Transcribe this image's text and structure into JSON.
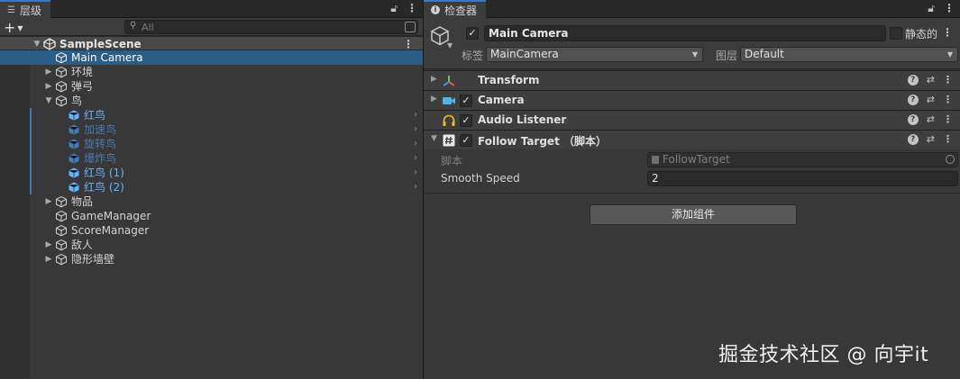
{
  "hierarchy": {
    "tab_label": "层级",
    "search_placeholder": "All",
    "scene_name": "SampleScene",
    "items": [
      {
        "label": "Main Camera",
        "state": "selected"
      },
      {
        "label": "环境",
        "state": "normal"
      },
      {
        "label": "弹弓",
        "state": "normal"
      },
      {
        "label": "鸟",
        "state": "expanded"
      },
      {
        "label": "红鸟",
        "state": "prefab"
      },
      {
        "label": "加速鸟",
        "state": "prefab-dim"
      },
      {
        "label": "旋转鸟",
        "state": "prefab-dim"
      },
      {
        "label": "爆炸鸟",
        "state": "prefab-dim"
      },
      {
        "label": "红鸟 (1)",
        "state": "prefab"
      },
      {
        "label": "红鸟 (2)",
        "state": "prefab"
      },
      {
        "label": "物品",
        "state": "normal"
      },
      {
        "label": "GameManager",
        "state": "normal"
      },
      {
        "label": "ScoreManager",
        "state": "normal"
      },
      {
        "label": "敌人",
        "state": "normal"
      },
      {
        "label": "隐形墙壁",
        "state": "normal"
      }
    ]
  },
  "inspector": {
    "tab_label": "检查器",
    "object_name": "Main Camera",
    "static_label": "静态的",
    "tag_label": "标签",
    "tag_value": "MainCamera",
    "layer_label": "图层",
    "layer_value": "Default",
    "components": [
      {
        "title": "Transform"
      },
      {
        "title": "Camera"
      },
      {
        "title": "Audio Listener"
      },
      {
        "title": "Follow Target （脚本）"
      }
    ],
    "script_label": "脚本",
    "script_value": "FollowTarget",
    "smooth_speed_label": "Smooth Speed",
    "smooth_speed_value": "2",
    "add_component_label": "添加组件"
  },
  "watermark": "掘金技术社区 @ 向宇it",
  "colors": {
    "selection": "#2c5d87",
    "prefab_text": "#6ab1f3",
    "accent": "#3a79bb"
  }
}
